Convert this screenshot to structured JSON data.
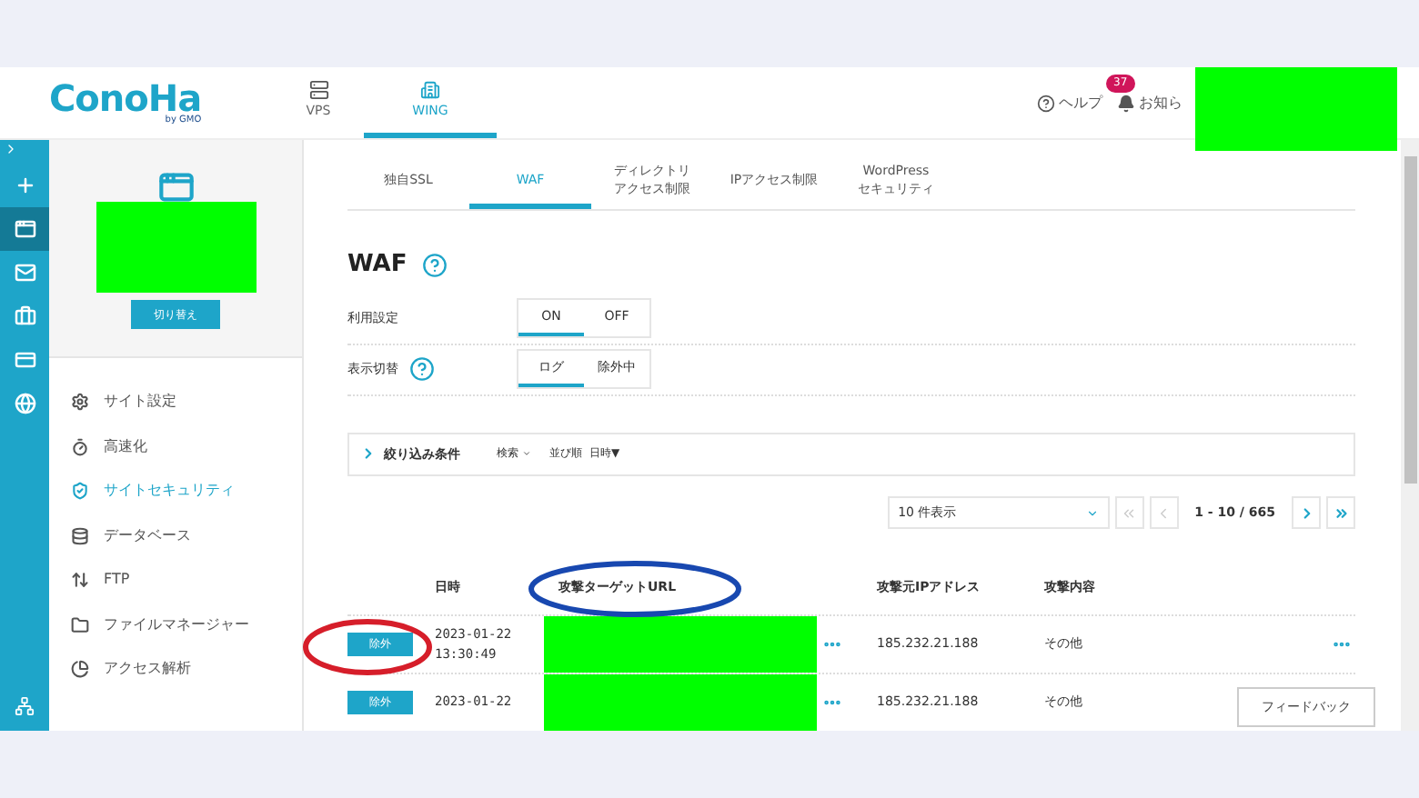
{
  "header": {
    "logo": "ConoHa",
    "logo_sub": "by GMO",
    "nav": [
      {
        "label": "VPS",
        "selected": false
      },
      {
        "label": "WING",
        "selected": true
      }
    ],
    "help": "ヘルプ",
    "notifications": {
      "badge": "37",
      "label": "お知ら"
    }
  },
  "rail": [
    {
      "kind": "plus",
      "selected": false
    },
    {
      "kind": "window",
      "selected": true
    },
    {
      "kind": "mail",
      "selected": false
    },
    {
      "kind": "case",
      "selected": false
    },
    {
      "kind": "card",
      "selected": false
    },
    {
      "kind": "globe",
      "selected": false
    }
  ],
  "sidebar": {
    "switch_button": "切り替え",
    "items": [
      {
        "kind": "settings",
        "label": "サイト設定",
        "selected": false
      },
      {
        "kind": "speed",
        "label": "高速化",
        "selected": false
      },
      {
        "kind": "shield",
        "label": "サイトセキュリティ",
        "selected": true
      },
      {
        "kind": "database",
        "label": "データベース",
        "selected": false
      },
      {
        "kind": "ftp",
        "label": "FTP",
        "selected": false
      },
      {
        "kind": "files",
        "label": "ファイルマネージャー",
        "selected": false
      },
      {
        "kind": "chart",
        "label": "アクセス解析",
        "selected": false
      }
    ]
  },
  "tabs": [
    {
      "lines": [
        "独自SSL"
      ],
      "selected": false
    },
    {
      "lines": [
        "WAF"
      ],
      "selected": true
    },
    {
      "lines": [
        "ディレクトリ",
        "アクセス制限"
      ],
      "selected": false
    },
    {
      "lines": [
        "IPアクセス制限"
      ],
      "selected": false
    },
    {
      "lines": [
        "WordPress",
        "セキュリティ"
      ],
      "selected": false
    }
  ],
  "title": "WAF",
  "settings": [
    {
      "label": "利用設定",
      "help": false,
      "options": [
        {
          "label": "ON",
          "selected": true
        },
        {
          "label": "OFF",
          "selected": false
        }
      ]
    },
    {
      "label": "表示切替",
      "help": true,
      "options": [
        {
          "label": "ログ",
          "selected": true
        },
        {
          "label": "除外中",
          "selected": false
        }
      ]
    }
  ],
  "filter": {
    "label": "絞り込み条件",
    "search": "検索",
    "sort_label": "並び順",
    "sort_value": "日時▼"
  },
  "pagination": {
    "per_page": "10 件表示",
    "range": "1 - 10 / 665"
  },
  "table": {
    "columns": [
      "",
      "日時",
      "攻撃ターゲットURL",
      "攻撃元IPアドレス",
      "攻撃内容"
    ],
    "rows": [
      {
        "button": "除外",
        "date": "2023-01-22",
        "time": "13:30:49",
        "ip": "185.232.21.188",
        "type": "その他"
      },
      {
        "button": "除外",
        "date": "2023-01-22",
        "time": "",
        "ip": "185.232.21.188",
        "type": "その他"
      }
    ]
  },
  "feedback": "フィードバック"
}
